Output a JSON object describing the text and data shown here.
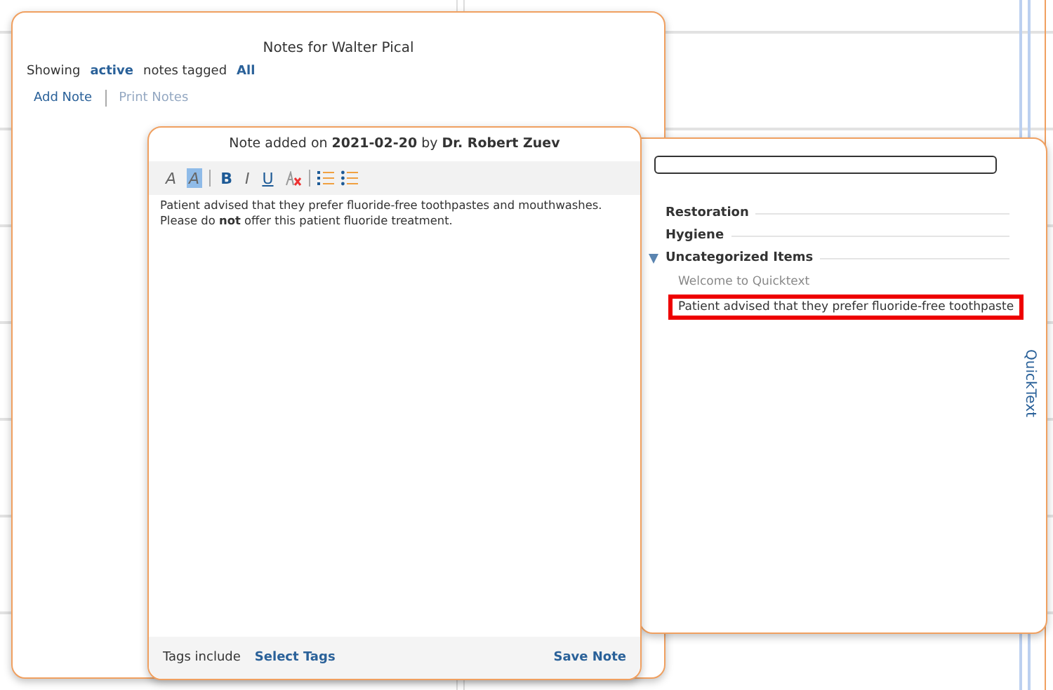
{
  "notes_panel": {
    "title": "Notes for Walter Pical",
    "filter": {
      "prefix": "Showing",
      "status": "active",
      "middle": "notes tagged",
      "tag": "All"
    },
    "actions": [
      {
        "label": "Add Note",
        "disabled": false
      },
      {
        "label": "Print Notes",
        "disabled": true
      }
    ]
  },
  "note_editor": {
    "header": "Note added on **2021-02-20** by **Dr. Robert Zuev**",
    "toolbar": [
      {
        "kind": "italic",
        "label": "A",
        "active": false
      },
      {
        "kind": "italic",
        "label": "A",
        "active": true
      },
      {
        "kind": "separator"
      },
      {
        "kind": "bold",
        "label": "B",
        "active": false
      },
      {
        "kind": "italic",
        "label": "I",
        "active": false
      },
      {
        "kind": "underline",
        "label": "U",
        "active": false
      },
      {
        "kind": "clear"
      },
      {
        "kind": "separator"
      },
      {
        "kind": "ordered-list"
      },
      {
        "kind": "bullet-list"
      }
    ],
    "body": [
      "Patient advised that they prefer fluoride-free toothpastes and mouthwashes.",
      "Please do **not** offer this patient fluoride treatment."
    ],
    "footer": {
      "tags_label": "Tags include",
      "select_tags": "Select Tags",
      "save": "Save Note"
    }
  },
  "quicktext": {
    "tab_label": "QuickText",
    "categories": [
      {
        "label": "Restoration",
        "expanded": false
      },
      {
        "label": "Hygiene",
        "expanded": false
      },
      {
        "label": "Uncategorized Items",
        "expanded": true,
        "children": [
          {
            "label": "Welcome to Quicktext",
            "selected": false
          },
          {
            "label": "Patient advised that they prefer fluoride-free toothpaste",
            "selected": true
          }
        ]
      }
    ]
  }
}
